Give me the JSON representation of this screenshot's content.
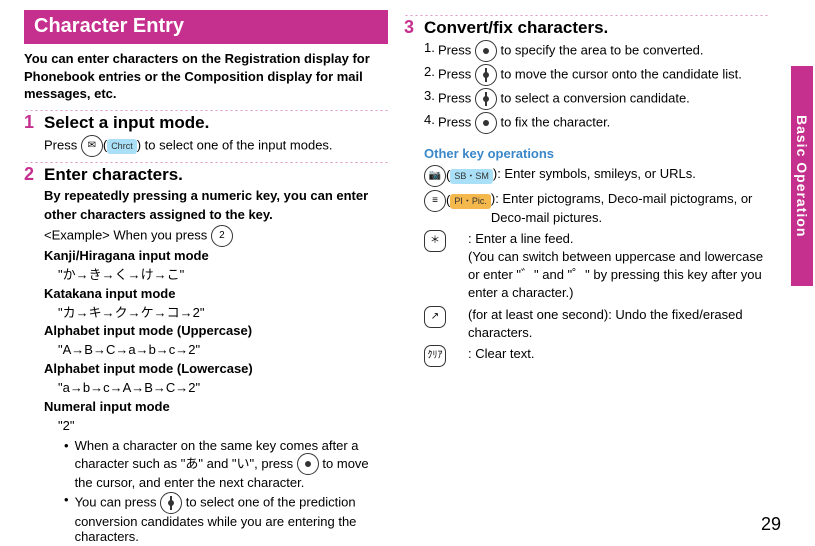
{
  "sidebar_label": "Basic Operation",
  "page_number": "29",
  "left": {
    "banner": "Character Entry",
    "lead": "You can enter characters on the Registration display for Phonebook entries or the Composition display for mail messages, etc.",
    "step1": {
      "num": "1",
      "title": "Select a input mode.",
      "press": "Press ",
      "select_text": ") to select one of the input modes.",
      "chrct_label": "Chrct"
    },
    "step2": {
      "num": "2",
      "title": "Enter characters.",
      "sub": "By repeatedly pressing a numeric key, you can enter other characters assigned to the key.",
      "example_prefix": "<Example> When you press ",
      "key2": "2",
      "m1_title": "Kanji/Hiragana input mode",
      "m1_seq": "\"か→き→く→け→こ\"",
      "m2_title": "Katakana input mode",
      "m2_seq": "\"カ→キ→ク→ケ→コ→2\"",
      "m3_title": "Alphabet input mode (Uppercase)",
      "m3_seq": "\"A→B→C→a→b→c→2\"",
      "m4_title": "Alphabet input mode (Lowercase)",
      "m4_seq": "\"a→b→c→A→B→C→2\"",
      "m5_title": "Numeral input mode",
      "m5_seq": "\"2\"",
      "bul1a": "When a character on the same key comes after a character such as \"あ\" and \"い\", press ",
      "bul1b": " to move the cursor, and enter the next character.",
      "bul2a": "You can press ",
      "bul2b": " to select one of the prediction conversion candidates while you are entering the characters."
    }
  },
  "right": {
    "step3": {
      "num": "3",
      "title": "Convert/fix characters.",
      "s1_n": "1.",
      "s1_a": "Press ",
      "s1_b": " to specify the area to be converted.",
      "s2_n": "2.",
      "s2_a": "Press ",
      "s2_b": " to move the cursor onto the candidate list.",
      "s3_n": "3.",
      "s3_a": "Press ",
      "s3_b": " to select a conversion candidate.",
      "s4_n": "4.",
      "s4_a": "Press ",
      "s4_b": " to fix the character."
    },
    "other_title": "Other key operations",
    "ops": {
      "o1_a": "(",
      "o1_badge": "SB・SM",
      "o1_b": "): Enter symbols, smileys, or URLs.",
      "o2_a": "(",
      "o2_badge": "PI・Pic.",
      "o2_b": "): Enter pictograms, Deco-mail pictograms, or Deco-mail pictures.",
      "o3_key": "＊",
      "o3_a": ": Enter a line feed.",
      "o3_b": "(You can switch between uppercase and lowercase or enter \"゛\" and \"゜\" by pressing this key after you enter a character.)",
      "o4_key": "↗",
      "o4_a": "(for at least one second): Undo the fixed/erased characters.",
      "o5_key": "ｸﾘｱ",
      "o5_a": ": Clear text."
    }
  }
}
